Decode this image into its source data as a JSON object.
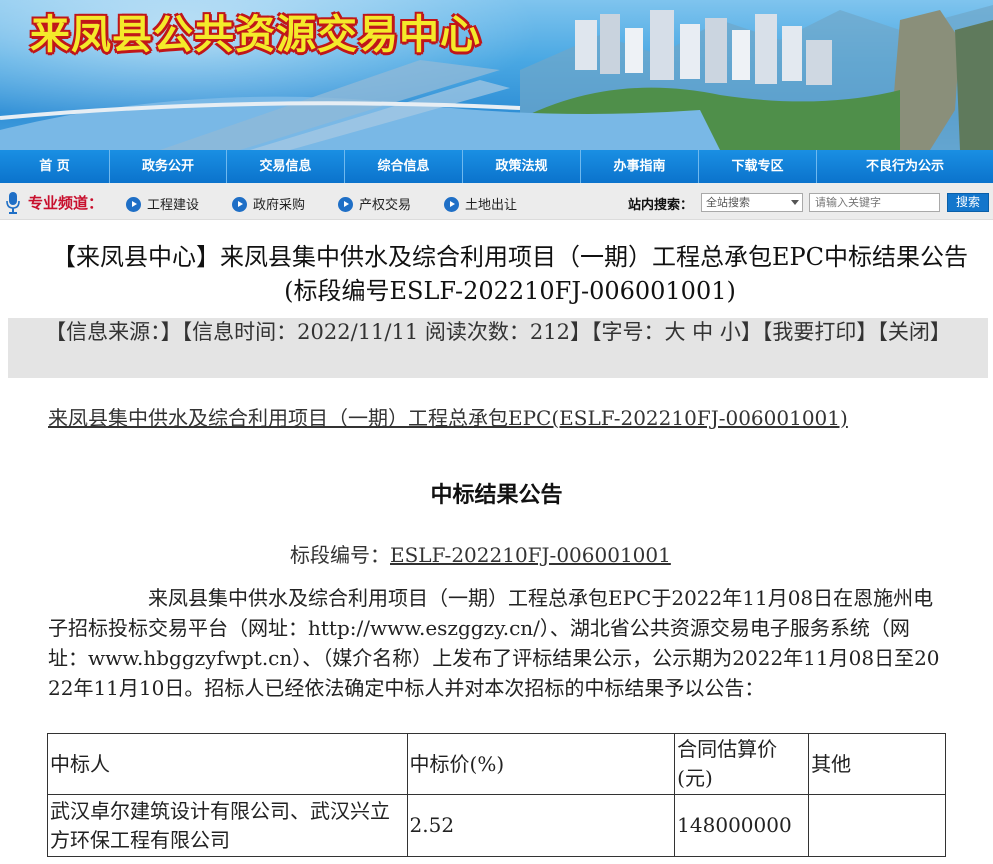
{
  "banner": {
    "title": "来凤县公共资源交易中心"
  },
  "nav": {
    "items": [
      "首 页",
      "政务公开",
      "交易信息",
      "综合信息",
      "政策法规",
      "办事指南",
      "下载专区",
      "不良行为公示"
    ]
  },
  "channel": {
    "label": "专业频道：",
    "links": [
      "工程建设",
      "政府采购",
      "产权交易",
      "土地出让"
    ],
    "search_label": "站内搜索：",
    "search_scope": "全站搜索",
    "search_placeholder": "请输入关键字",
    "search_button": "搜索"
  },
  "article": {
    "title": "【来凤县中心】来凤县集中供水及综合利用项目（一期）工程总承包EPC中标结果公告(标段编号ESLF-202210FJ-006001001)",
    "info": "【信息来源：】【信息时间：2022/11/11 阅读次数：212】【字号：大 中 小】【我要打印】【关闭】",
    "doc_link": "来凤县集中供水及综合利用项目（一期）工程总承包EPC(ESLF-202210FJ-006001001)",
    "heading": "中标结果公告",
    "section_label": "标段编号：",
    "section_value": "ESLF-202210FJ-006001001",
    "body": "来凤县集中供水及综合利用项目（一期）工程总承包EPC于2022年11月08日在恩施州电子招标投标交易平台（网址：http://www.eszggzy.cn/）、湖北省公共资源交易电子服务系统（网址：www.hbggzyfwpt.cn）、（媒介名称）上发布了评标结果公示，公示期为2022年11月08日至2022年11月10日。招标人已经依法确定中标人并对本次招标的中标结果予以公告："
  },
  "table": {
    "headers": [
      "中标人",
      "中标价(%)",
      "合同估算价(元)",
      "其他"
    ],
    "rows": [
      [
        "武汉卓尔建筑设计有限公司、武汉兴立方环保工程有限公司",
        "2.52",
        "148000000",
        ""
      ]
    ]
  },
  "colors": {
    "nav_blue": "#0b73cc",
    "channel_red": "#c8102e",
    "title_yellow": "#f4ea2a",
    "title_outline": "#c0161a"
  }
}
